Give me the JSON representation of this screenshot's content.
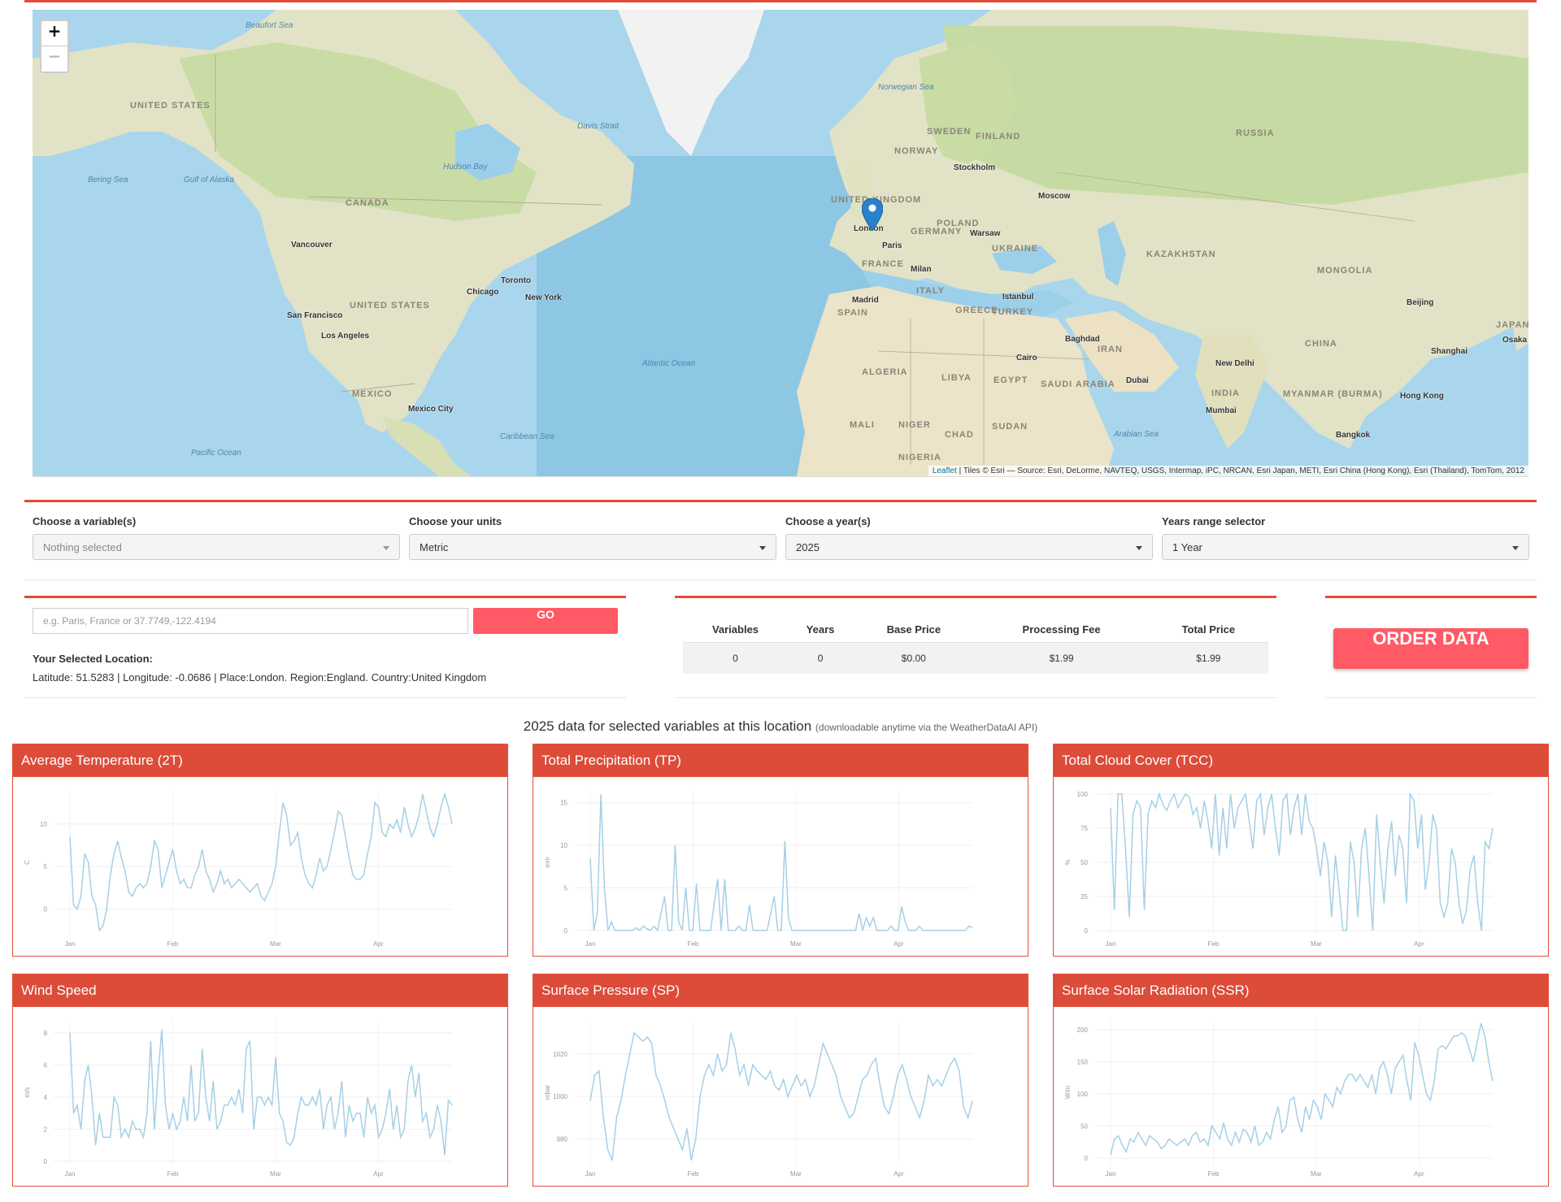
{
  "map": {
    "zoom_in_label": "+",
    "zoom_out_label": "−",
    "attribution_leaflet": "Leaflet",
    "attribution_text": " | Tiles © Esri — Source: Esri, DeLorme, NAVTEQ, USGS, Intermap, iPC, NRCAN, Esri Japan, METI, Esri China (Hong Kong), Esri (Thailand), TomTom, 2012",
    "ocean_labels": [
      "Beaufort Sea",
      "Bering Sea",
      "Gulf of Alaska",
      "Hudson Bay",
      "Davis Strait",
      "Norwegian Sea",
      "Atlantic Ocean",
      "Caribbean Sea",
      "Pacific Ocean",
      "Arabian Sea"
    ],
    "country_labels": [
      "UNITED STATES",
      "CANADA",
      "UNITED STATES",
      "MEXICO",
      "SWEDEN",
      "FINLAND",
      "NORWAY",
      "RUSSIA",
      "UNITED KINGDOM",
      "GERMANY",
      "POLAND",
      "UKRAINE",
      "FRANCE",
      "ITALY",
      "SPAIN",
      "GREECE",
      "TURKEY",
      "KAZAKHSTAN",
      "MONGOLIA",
      "CHINA",
      "IRAN",
      "ALGERIA",
      "LIBYA",
      "EGYPT",
      "SAUDI ARABIA",
      "INDIA",
      "MYANMAR (BURMA)",
      "MALI",
      "NIGER",
      "CHAD",
      "SUDAN",
      "NIGERIA",
      "JAPAN"
    ],
    "city_labels": [
      "Vancouver",
      "Toronto",
      "Chicago",
      "New York",
      "San Francisco",
      "Los Angeles",
      "Mexico City",
      "Stockholm",
      "Moscow",
      "London",
      "Paris",
      "Warsaw",
      "Milan",
      "Madrid",
      "Istanbul",
      "Baghdad",
      "Cairo",
      "Dubai",
      "New Delhi",
      "Mumbai",
      "Beijing",
      "Shanghai",
      "Osaka",
      "Hong Kong",
      "Bangkok"
    ],
    "marker_label": "London"
  },
  "selectors": [
    {
      "label": "Choose a variable(s)",
      "value": "Nothing selected"
    },
    {
      "label": "Choose your units",
      "value": "Metric"
    },
    {
      "label": "Choose a year(s)",
      "value": "2025"
    },
    {
      "label": "Years range selector",
      "value": "1 Year"
    }
  ],
  "location": {
    "placeholder": "e.g. Paris, France or 37.7749,-122.4194",
    "go_label": "GO",
    "selected_title": "Your Selected Location:",
    "selected_text": "Latitude: 51.5283 | Longitude: -0.0686 | Place:London. Region:England. Country:United Kingdom"
  },
  "pricing": {
    "headers": [
      "Variables",
      "Years",
      "Base Price",
      "Processing Fee",
      "Total Price"
    ],
    "row": [
      "0",
      "0",
      "$0.00",
      "$1.99",
      "$1.99"
    ]
  },
  "order_label": "ORDER DATA",
  "section": {
    "title": "2025 data for selected variables at this location",
    "subtitle": "(downloadable anytime via the WeatherDataAI API)"
  },
  "chart_data": [
    {
      "type": "line",
      "title": "Average Temperature (2T)",
      "ylabel": "C",
      "x_ticks": [
        "Jan",
        "Feb",
        "Mar",
        "Apr"
      ],
      "y_ticks": [
        "0",
        "5",
        "10"
      ],
      "ylim": [
        -3,
        14
      ],
      "color": "#a6cfe6",
      "values": [
        8.5,
        0.5,
        0,
        1.5,
        6.5,
        5.5,
        1.5,
        0.5,
        -2.5,
        -2,
        0,
        4,
        6.5,
        8,
        6,
        4.5,
        2,
        1.5,
        2.5,
        3,
        2.5,
        3,
        5,
        8,
        7,
        2.5,
        4,
        5.5,
        7,
        4.5,
        3,
        3.5,
        2.5,
        2.5,
        4,
        5,
        7,
        4.5,
        3.5,
        2,
        3,
        4.5,
        3,
        3.5,
        2.5,
        3,
        3.5,
        3,
        2.5,
        2,
        2.5,
        3,
        1.5,
        1,
        2,
        3,
        5,
        9,
        12.5,
        11,
        7.5,
        8,
        9,
        6,
        4,
        3,
        2.5,
        4,
        6,
        4.5,
        5,
        7,
        9,
        11.5,
        11,
        8.5,
        6,
        4,
        3.5,
        3.5,
        4,
        6.5,
        8.5,
        12.5,
        12,
        9,
        8.5,
        10,
        9.5,
        10.5,
        9,
        12,
        10,
        8.5,
        9.5,
        11,
        13.5,
        11.5,
        9.5,
        8.5,
        10,
        12,
        13.5,
        12,
        10
      ]
    },
    {
      "type": "line",
      "title": "Total Precipitation (TP)",
      "ylabel": "mm",
      "x_ticks": [
        "Jan",
        "Feb",
        "Mar",
        "Apr"
      ],
      "y_ticks": [
        "0",
        "5",
        "10",
        "15"
      ],
      "ylim": [
        -0.5,
        16.5
      ],
      "color": "#a6cfe6",
      "values": [
        8.5,
        0,
        2,
        16,
        5,
        0,
        1,
        0,
        0,
        0,
        0,
        0,
        0,
        0.3,
        0,
        0.5,
        0.2,
        0,
        0.5,
        0,
        2,
        4,
        0,
        0,
        10,
        1,
        0,
        5,
        0,
        0,
        5.5,
        0,
        0,
        0,
        0,
        3,
        6,
        0,
        6,
        0,
        0,
        0,
        0.5,
        0,
        0,
        3,
        0,
        0,
        0,
        0,
        0,
        2,
        4,
        0,
        0,
        10.5,
        1.5,
        0,
        0,
        0,
        0,
        0,
        0,
        0,
        0,
        0,
        0,
        0,
        0,
        0,
        0,
        0,
        0,
        0,
        0,
        0,
        2,
        0,
        1.5,
        0.5,
        1.5,
        0,
        0,
        0,
        0,
        0.5,
        0,
        0,
        2.8,
        1,
        0,
        0,
        0,
        0.5,
        0,
        0,
        0,
        0,
        0,
        0,
        0,
        0,
        0,
        0,
        0,
        0,
        0,
        0.5,
        0.3
      ]
    },
    {
      "type": "line",
      "title": "Total Cloud Cover (TCC)",
      "ylabel": "%",
      "x_ticks": [
        "Jan",
        "Feb",
        "Mar",
        "Apr"
      ],
      "y_ticks": [
        "0",
        "25",
        "50",
        "75",
        "100"
      ],
      "ylim": [
        -3,
        103
      ],
      "color": "#a6cfe6",
      "values": [
        90,
        15,
        100,
        100,
        60,
        10,
        85,
        95,
        90,
        15,
        85,
        95,
        90,
        100,
        92,
        88,
        95,
        100,
        90,
        95,
        100,
        98,
        85,
        90,
        75,
        95,
        80,
        60,
        100,
        55,
        90,
        60,
        100,
        75,
        90,
        95,
        100,
        80,
        60,
        95,
        100,
        70,
        90,
        100,
        75,
        55,
        95,
        100,
        70,
        90,
        100,
        70,
        100,
        80,
        75,
        60,
        40,
        65,
        50,
        10,
        55,
        30,
        0,
        0,
        65,
        50,
        10,
        60,
        75,
        40,
        0,
        85,
        50,
        20,
        60,
        80,
        40,
        70,
        60,
        20,
        100,
        95,
        60,
        85,
        30,
        50,
        85,
        75,
        20,
        10,
        20,
        60,
        50,
        20,
        5,
        15,
        45,
        55,
        20,
        0,
        65,
        60,
        75
      ]
    },
    {
      "type": "line",
      "title": "Wind Speed",
      "ylabel": "m/s",
      "x_ticks": [
        "Jan",
        "Feb",
        "Mar",
        "Apr"
      ],
      "y_ticks": [
        "0",
        "2",
        "4",
        "6",
        "8"
      ],
      "ylim": [
        -0.2,
        8.8
      ],
      "color": "#a6cfe6",
      "values": [
        8,
        3,
        3.5,
        2,
        5,
        6,
        4,
        1,
        3,
        1.5,
        1.5,
        1.5,
        4,
        3.5,
        1.5,
        2,
        1.5,
        2.5,
        2,
        2,
        1.5,
        3,
        7.5,
        2,
        5.5,
        8.2,
        3.5,
        2,
        3,
        2,
        2.5,
        4,
        2.5,
        6,
        2.5,
        3,
        7,
        4,
        2.5,
        5,
        2,
        2.5,
        3.5,
        3.5,
        4,
        3.5,
        4.5,
        3,
        7,
        7.5,
        2,
        4,
        4,
        3.5,
        4,
        3.5,
        6.5,
        3,
        2.5,
        1.2,
        1,
        1.5,
        3,
        4,
        3.5,
        3.5,
        4,
        3.5,
        4.5,
        2,
        3.5,
        4,
        2,
        3,
        5,
        1.5,
        3.5,
        2.5,
        3,
        3,
        1.5,
        4,
        3,
        3.5,
        1.5,
        2,
        3,
        4.5,
        2,
        3.5,
        1.5,
        2,
        5,
        6,
        4,
        5.5,
        2.5,
        3,
        1.5,
        2,
        3.5,
        2.5,
        0.4,
        3.8,
        3.5
      ]
    },
    {
      "type": "line",
      "title": "Surface Pressure (SP)",
      "ylabel": "mbar",
      "x_ticks": [
        "Jan",
        "Feb",
        "Mar",
        "Apr"
      ],
      "y_ticks": [
        "980",
        "1000",
        "1020"
      ],
      "ylim": [
        968,
        1036
      ],
      "color": "#a6cfe6",
      "values": [
        998,
        1010,
        1012,
        990,
        975,
        970,
        990,
        998,
        1010,
        1020,
        1030,
        1028,
        1026,
        1028,
        1025,
        1010,
        1005,
        998,
        990,
        985,
        980,
        975,
        985,
        970,
        980,
        1000,
        1010,
        1015,
        1010,
        1020,
        1012,
        1015,
        1030,
        1022,
        1010,
        1015,
        1005,
        1015,
        1012,
        1010,
        1008,
        1012,
        1005,
        1003,
        1008,
        1000,
        1005,
        1010,
        1005,
        1008,
        1000,
        1005,
        1015,
        1025,
        1020,
        1015,
        1010,
        1000,
        995,
        990,
        992,
        1000,
        1008,
        1010,
        1015,
        1018,
        1005,
        995,
        992,
        1000,
        1010,
        1015,
        1008,
        1000,
        995,
        990,
        998,
        1010,
        1005,
        1008,
        1005,
        1010,
        1015,
        1018,
        1012,
        995,
        990,
        998
      ]
    },
    {
      "type": "line",
      "title": "Surface Solar Radiation (SSR)",
      "ylabel": "W/m",
      "x_ticks": [
        "Jan",
        "Feb",
        "Mar",
        "Apr"
      ],
      "y_ticks": [
        "0",
        "50",
        "100",
        "150",
        "200"
      ],
      "ylim": [
        -10,
        215
      ],
      "color": "#a6cfe6",
      "values": [
        5,
        30,
        35,
        20,
        10,
        30,
        25,
        40,
        30,
        20,
        35,
        30,
        25,
        15,
        20,
        30,
        25,
        20,
        25,
        30,
        20,
        35,
        40,
        25,
        30,
        20,
        50,
        40,
        30,
        55,
        30,
        20,
        40,
        25,
        45,
        40,
        25,
        50,
        20,
        25,
        40,
        30,
        60,
        80,
        40,
        50,
        90,
        95,
        60,
        40,
        80,
        60,
        90,
        80,
        60,
        100,
        90,
        80,
        110,
        100,
        120,
        130,
        130,
        120,
        130,
        120,
        110,
        130,
        100,
        140,
        150,
        130,
        100,
        140,
        150,
        160,
        120,
        90,
        180,
        160,
        130,
        100,
        90,
        120,
        170,
        175,
        170,
        180,
        190,
        190,
        195,
        190,
        170,
        150,
        180,
        210,
        190,
        150,
        120
      ]
    }
  ]
}
